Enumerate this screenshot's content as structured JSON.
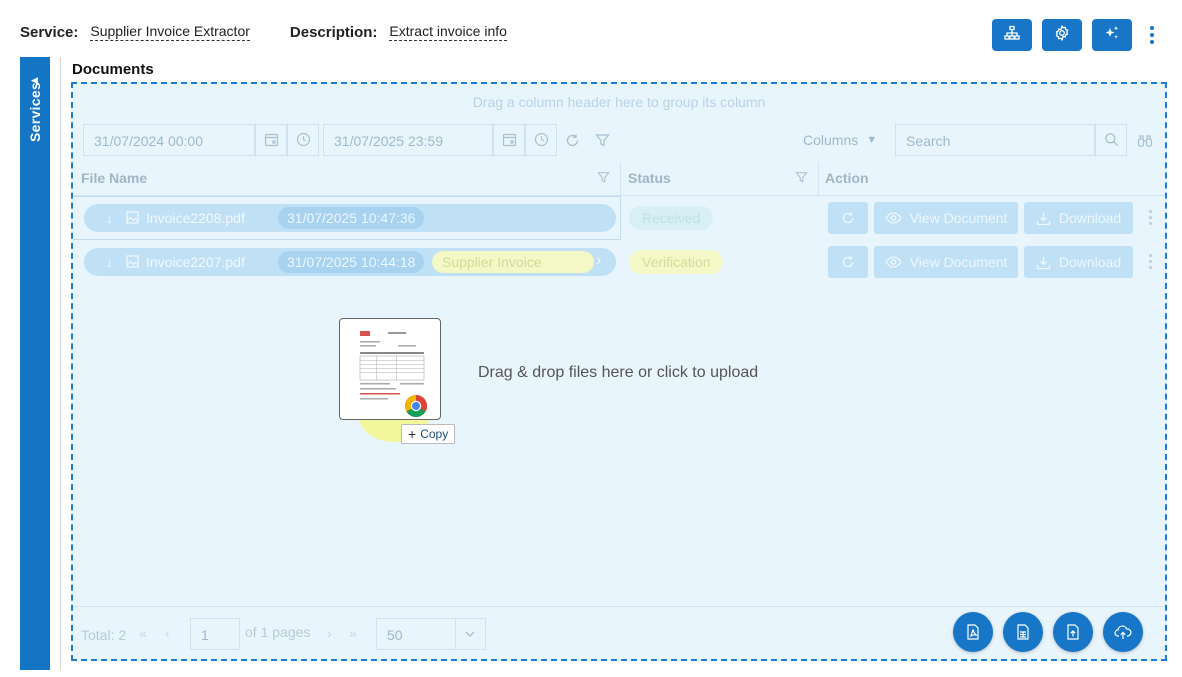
{
  "header": {
    "service_label": "Service:",
    "service_value": "Supplier Invoice Extractor",
    "description_label": "Description:",
    "description_value": "Extract invoice info"
  },
  "top_actions": {
    "icons": [
      "sitemap-icon",
      "gear-icon",
      "sparkle-icon",
      "kebab-icon"
    ]
  },
  "sidebar": {
    "label": "Services"
  },
  "documents": {
    "title": "Documents",
    "group_hint": "Drag a column header here to group its column",
    "toolbar": {
      "start_date": "31/07/2024 00:00",
      "end_date": "31/07/2025 23:59",
      "columns_label": "Columns",
      "search_placeholder": "Search"
    },
    "columns": [
      "File Name",
      "Status",
      "Action"
    ],
    "rows": [
      {
        "file": "Invoice2208.pdf",
        "time": "31/07/2025 10:47:36",
        "tag": "",
        "status": "Received",
        "view": "View Document",
        "download": "Download"
      },
      {
        "file": "Invoice2207.pdf",
        "time": "31/07/2025 10:44:18",
        "tag": "Supplier Invoice",
        "status": "Verification",
        "view": "View Document",
        "download": "Download"
      }
    ],
    "upload_text": "Drag & drop files here or click to upload",
    "copy_label": "Copy",
    "pager": {
      "total": "Total: 2",
      "page": "1",
      "of_pages": "of 1 pages",
      "page_size": "50"
    },
    "fab_icons": [
      "pdf-file-icon",
      "spreadsheet-icon",
      "file-upload-icon",
      "cloud-upload-icon"
    ]
  },
  "colors": {
    "primary": "#1776c8",
    "received": "#d8f0f5",
    "verification": "#f3f8c6"
  }
}
